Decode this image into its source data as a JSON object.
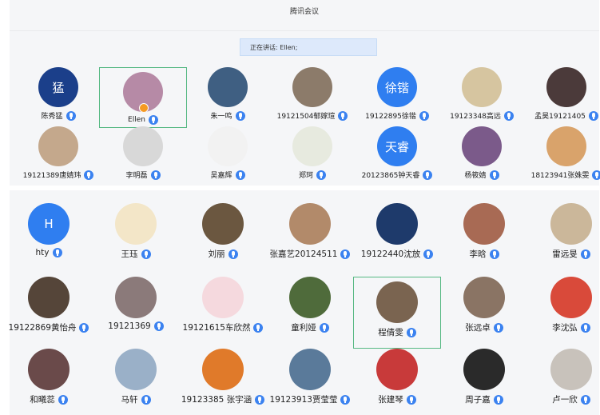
{
  "title": "腾讯会议",
  "speaking_text": "正在讲话: Ellen;",
  "panel1": [
    {
      "name": "陈秀猛",
      "bg": "#1b3f8a",
      "avatar_text": "猛"
    },
    {
      "name": "Ellen",
      "bg": "#b68aa6",
      "highlight": true,
      "badge": true
    },
    {
      "name": "朱一鸣",
      "bg": "#3f5f82"
    },
    {
      "name": "19121504郁嫁瑄",
      "bg": "#8c7b6a"
    },
    {
      "name": "19122895徐锴",
      "bg": "#2f7ef0",
      "avatar_text": "徐锴"
    },
    {
      "name": "19123348高远",
      "bg": "#d6c5a0"
    },
    {
      "name": "孟昊19121405",
      "bg": "#4b3a3a"
    },
    {
      "name": "19121389唐婧玮",
      "bg": "#c4a88c"
    },
    {
      "name": "李明磊",
      "bg": "#d8d8d8"
    },
    {
      "name": "吴嘉辉",
      "bg": "#f2f2f2"
    },
    {
      "name": "郑珂",
      "bg": "#e7eadf"
    },
    {
      "name": "20123865钟天睿",
      "bg": "#2f7ef0",
      "avatar_text": "天睿"
    },
    {
      "name": "杨筱婧",
      "bg": "#7b5a8a"
    },
    {
      "name": "18123941张姝雯",
      "bg": "#d9a36b"
    }
  ],
  "panel2": [
    {
      "name": "hty",
      "bg": "#2f7ef0",
      "avatar_text": "H"
    },
    {
      "name": "王珏",
      "bg": "#f3e6c8"
    },
    {
      "name": "刘丽",
      "bg": "#6b5740"
    },
    {
      "name": "张嘉艺20124511",
      "bg": "#b28a6a"
    },
    {
      "name": "19122440沈放",
      "bg": "#1e3a6b"
    },
    {
      "name": "李晗",
      "bg": "#a86a54"
    },
    {
      "name": "雷远旻",
      "bg": "#cbb79a"
    },
    {
      "name": "19122869黄怡舟",
      "bg": "#554539"
    },
    {
      "name": "19121369",
      "bg": "#8b7a7a"
    },
    {
      "name": "19121615车欣然",
      "bg": "#f5d9de"
    },
    {
      "name": "童利娅",
      "bg": "#4f6b3b"
    },
    {
      "name": "程倩雯",
      "bg": "#7a6450",
      "highlight": true
    },
    {
      "name": "张远卓",
      "bg": "#8a7464"
    },
    {
      "name": "李沈弘",
      "bg": "#d94a3a"
    },
    {
      "name": "和曦蕊",
      "bg": "#6a4a4a"
    },
    {
      "name": "马轩",
      "bg": "#9ab0c8"
    },
    {
      "name": "19123385 张宇涵",
      "bg": "#e07a2a"
    },
    {
      "name": "19123913贾莹莹",
      "bg": "#5a7a9a"
    },
    {
      "name": "张建琴",
      "bg": "#c83a3a"
    },
    {
      "name": "周子嘉",
      "bg": "#2a2a2a"
    },
    {
      "name": "卢一欣",
      "bg": "#c8c2bb"
    }
  ]
}
